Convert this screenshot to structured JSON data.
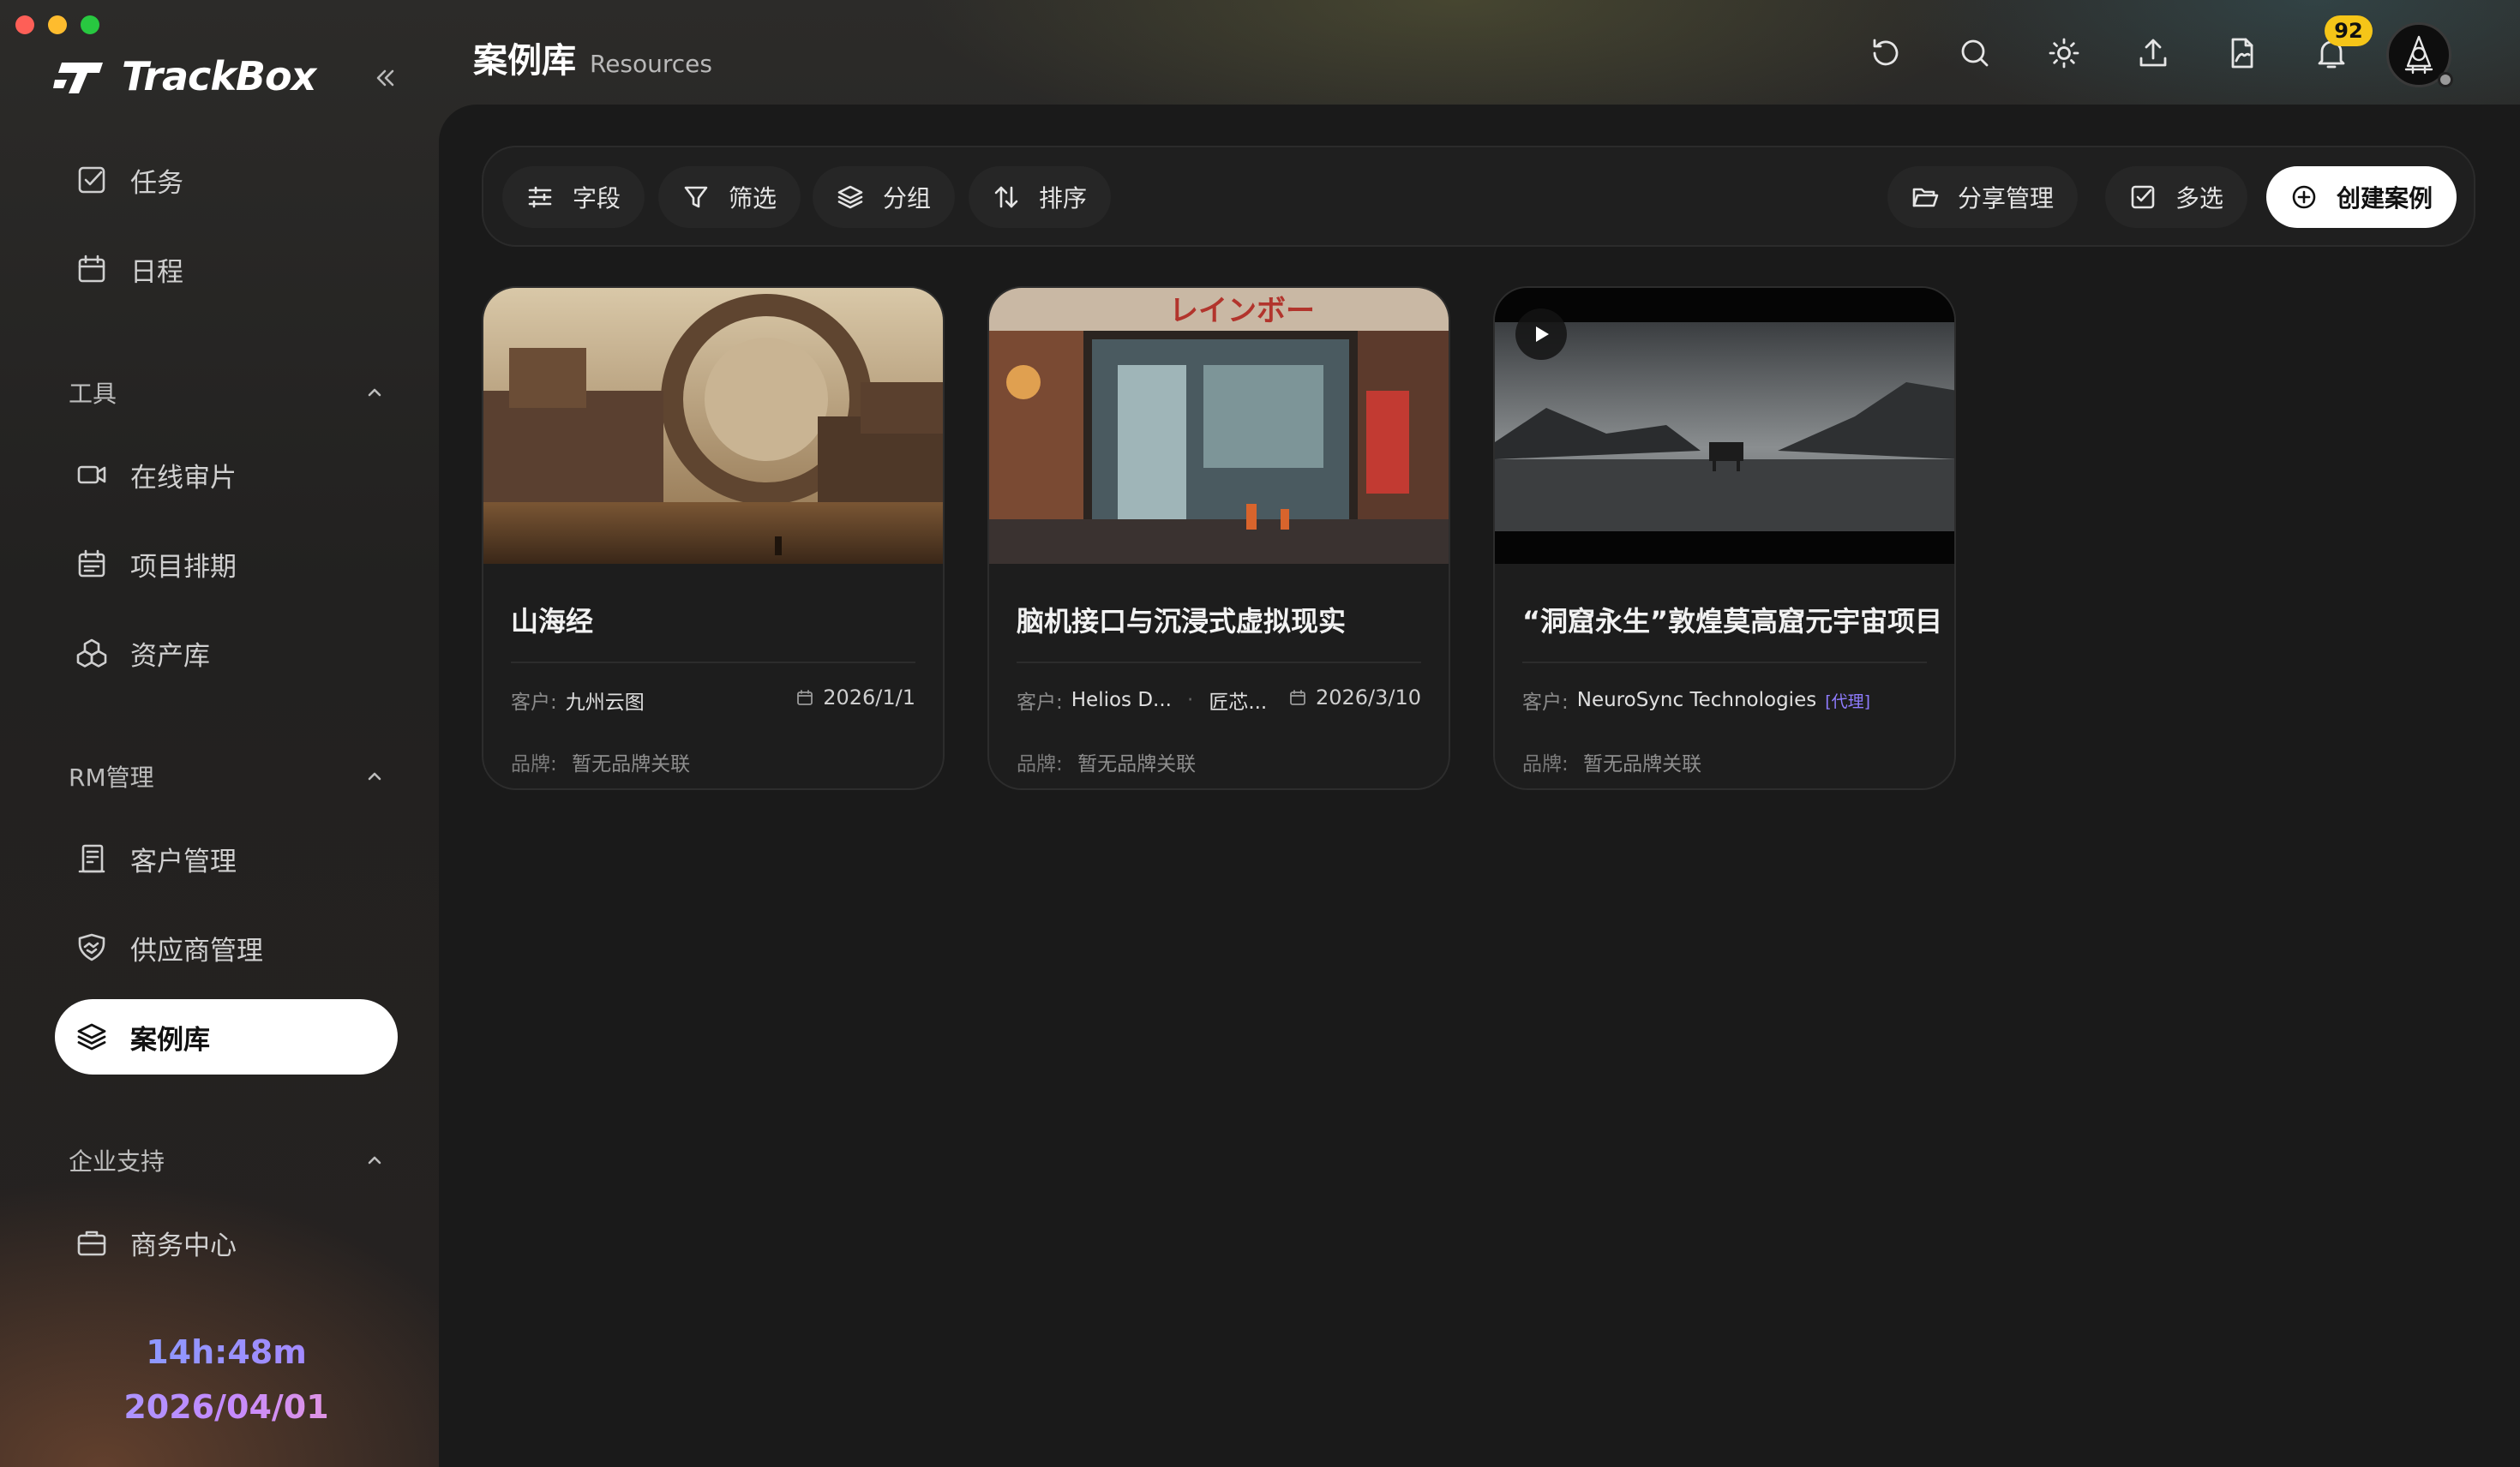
{
  "app": {
    "name": "TrackBox"
  },
  "sidebar": {
    "top_items": [
      {
        "label": "任务",
        "icon": "task-check-icon"
      },
      {
        "label": "日程",
        "icon": "calendar-icon"
      }
    ],
    "sections": [
      {
        "title": "工具",
        "items": [
          {
            "label": "在线审片",
            "icon": "video-camera-icon"
          },
          {
            "label": "项目排期",
            "icon": "schedule-icon"
          },
          {
            "label": "资产库",
            "icon": "assets-icon"
          }
        ]
      },
      {
        "title": "RM管理",
        "items": [
          {
            "label": "客户管理",
            "icon": "client-icon"
          },
          {
            "label": "供应商管理",
            "icon": "handshake-icon"
          },
          {
            "label": "案例库",
            "icon": "layers-icon",
            "active": true
          }
        ]
      },
      {
        "title": "企业支持",
        "items": [
          {
            "label": "商务中心",
            "icon": "briefcase-icon"
          }
        ]
      }
    ],
    "clock": {
      "time": "14h:48m",
      "date": "2026/04/01"
    }
  },
  "header": {
    "title": "案例库",
    "subtitle": "Resources",
    "notification_count": "92"
  },
  "toolbar": {
    "fields_label": "字段",
    "filter_label": "筛选",
    "group_label": "分组",
    "sort_label": "排序",
    "share_label": "分享管理",
    "multiselect_label": "多选",
    "create_label": "创建案例"
  },
  "cards": [
    {
      "title": "山海经",
      "client_label": "客户:",
      "client": "九州云图",
      "date": "2026/1/1",
      "brand_label": "品牌:",
      "brand": "暂无品牌关联"
    },
    {
      "title": "脑机接口与沉浸式虚拟现实",
      "client_label": "客户:",
      "client": "Helios D...",
      "client2": "匠芯...",
      "date": "2026/3/10",
      "brand_label": "品牌:",
      "brand": "暂无品牌关联",
      "image_sign": "レインボー"
    },
    {
      "title": "“洞窟永生”敦煌莫高窟元宇宙项目",
      "client_label": "客户:",
      "client": "NeuroSync Technologies",
      "client_tag": "[代理]",
      "brand_label": "品牌:",
      "brand": "暂无品牌关联",
      "has_video": true
    }
  ],
  "colors": {
    "accent_white": "#ffffff",
    "badge": "#f5c518",
    "tag_purple": "#8f7cff",
    "panel": "#1a1a1a"
  }
}
